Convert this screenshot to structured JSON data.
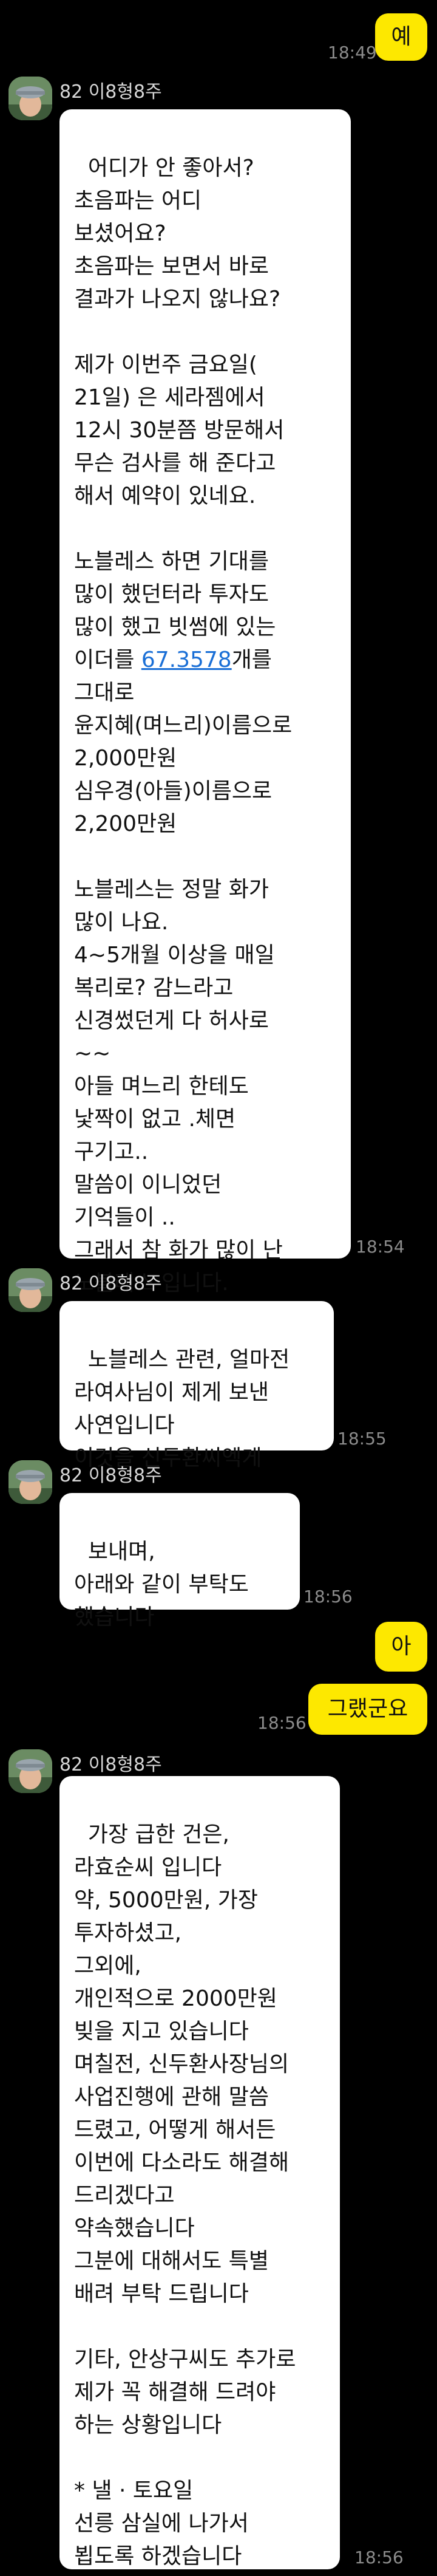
{
  "sender": {
    "name": "82 이8형8주"
  },
  "messages": {
    "m1": {
      "text": "예",
      "time": "18:49"
    },
    "m2": {
      "part1": "어디가 안 좋아서?\n초음파는 어디\n보셨어요?\n초음파는 보면서 바로\n결과가 나오지 않나요?\n\n제가 이번주 금요일(\n21일) 은 세라젬에서\n12시 30분쯤 방문해서\n무슨 검사를 해 준다고\n해서 예약이 있네요.\n\n노블레스 하면 기대를\n많이 했던터라 투자도\n많이 했고 빗썸에 있는\n이더를 ",
      "link": "67.3578",
      "part2": "개를\n그대로\n윤지혜(며느리)이름으로\n2,000만원\n심우경(아들)이름으로\n2,200만원\n\n노블레스는 정말 화가\n많이 나요.\n4~5개월 이상을 매일\n복리로? 감느라고\n신경썼던게 다 허사로\n~~\n아들 며느리 한테도\n낯짝이 없고 .체면\n구기고..\n말씀이 이니었던\n기억들이 ..\n그래서 참 화가 많이 난\n노블레스 입니다.",
      "time": "18:54"
    },
    "m3": {
      "text": "노블레스 관련, 얼마전\n라여사님이 제게 보낸\n사연입니다\n이것을 신두환씨엑게",
      "time": "18:55"
    },
    "m4": {
      "text": "보내며,\n아래와 같이 부탁도\n했습니다",
      "time": "18:56"
    },
    "m5": {
      "text": "아"
    },
    "m6": {
      "text": "그랬군요",
      "time": "18:56"
    },
    "m7": {
      "text": "가장 급한 건은,\n라효순씨 입니다\n약, 5000만원, 가장\n투자하셨고,\n그외에,\n개인적으로 2000만원\n빚을 지고 있습니다\n며칠전, 신두환사장님의\n사업진행에 관해 말씀\n드렸고, 어떻게 해서든\n이번에 다소라도 해결해\n드리겠다고\n약속했습니다\n그분에 대해서도 특별\n배려 부탁 드립니다\n\n기타, 안상구씨도 추가로\n제가 꼭 해결해 드려야\n하는 상황입니다\n\n* 낼 · 토요일\n선릉 삼실에 나가서\n뵙도록 하겠습니다",
      "time": "18:56"
    }
  },
  "colors": {
    "background": "#000000",
    "incoming_bubble": "#ffffff",
    "outgoing_bubble": "#fde800",
    "link": "#1a6fd6"
  },
  "icons": {
    "avatar": "profile-avatar-icon"
  }
}
